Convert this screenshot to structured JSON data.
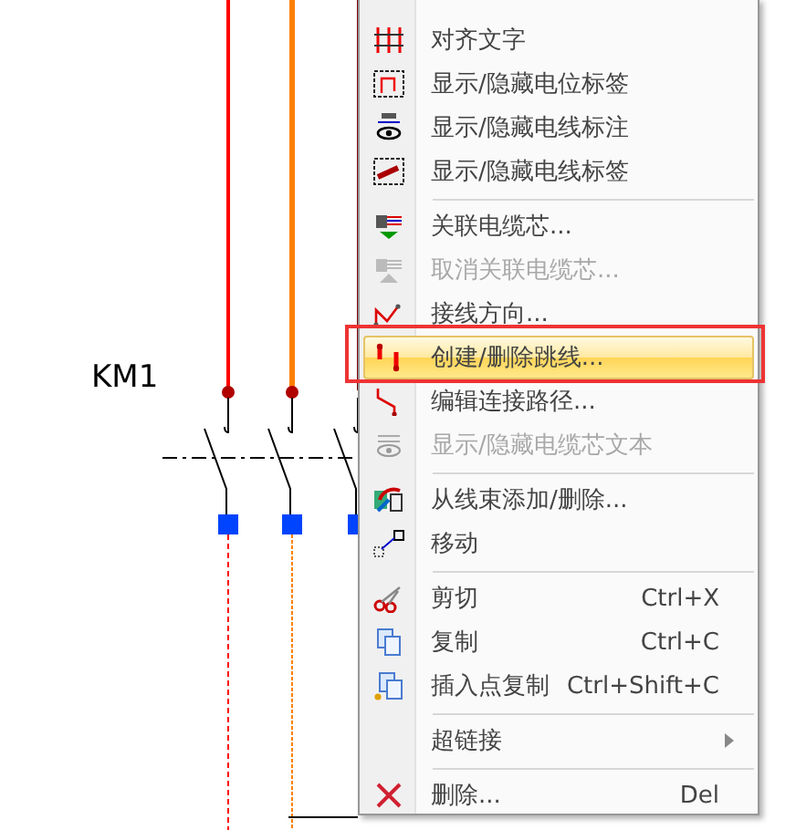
{
  "schematic": {
    "label": "KM1"
  },
  "menu": {
    "items": [
      {
        "kind": "item",
        "label": "对齐文字",
        "disabled": false,
        "selected": false
      },
      {
        "kind": "item",
        "label": "显示/隐藏电位标签",
        "disabled": false,
        "selected": false
      },
      {
        "kind": "item",
        "label": "显示/隐藏电线标注",
        "disabled": false,
        "selected": false
      },
      {
        "kind": "item",
        "label": "显示/隐藏电线标签",
        "disabled": false,
        "selected": false
      },
      {
        "kind": "separator"
      },
      {
        "kind": "item",
        "label": "关联电缆芯...",
        "disabled": false,
        "selected": false
      },
      {
        "kind": "item",
        "label": "取消关联电缆芯...",
        "disabled": true,
        "selected": false
      },
      {
        "kind": "item",
        "label": "接线方向...",
        "disabled": false,
        "selected": false
      },
      {
        "kind": "item",
        "label": "创建/删除跳线...",
        "disabled": false,
        "selected": true,
        "framed": true
      },
      {
        "kind": "item",
        "label": "编辑连接路径...",
        "disabled": false,
        "selected": false
      },
      {
        "kind": "item",
        "label": "显示/隐藏电缆芯文本",
        "disabled": true,
        "selected": false
      },
      {
        "kind": "separator"
      },
      {
        "kind": "item",
        "label": "从线束添加/删除...",
        "disabled": false,
        "selected": false
      },
      {
        "kind": "item",
        "label": "移动",
        "disabled": false,
        "selected": false
      },
      {
        "kind": "separator"
      },
      {
        "kind": "item",
        "label": "剪切",
        "shortcut": "Ctrl+X",
        "disabled": false,
        "selected": false
      },
      {
        "kind": "item",
        "label": "复制",
        "shortcut": "Ctrl+C",
        "disabled": false,
        "selected": false
      },
      {
        "kind": "item",
        "label": "插入点复制",
        "shortcut": "Ctrl+Shift+C",
        "disabled": false,
        "selected": false
      },
      {
        "kind": "separator"
      },
      {
        "kind": "submenu",
        "label": "超链接",
        "disabled": false,
        "selected": false
      },
      {
        "kind": "separator"
      },
      {
        "kind": "item",
        "label": "删除...",
        "shortcut": "Del",
        "disabled": false,
        "selected": false
      }
    ]
  }
}
